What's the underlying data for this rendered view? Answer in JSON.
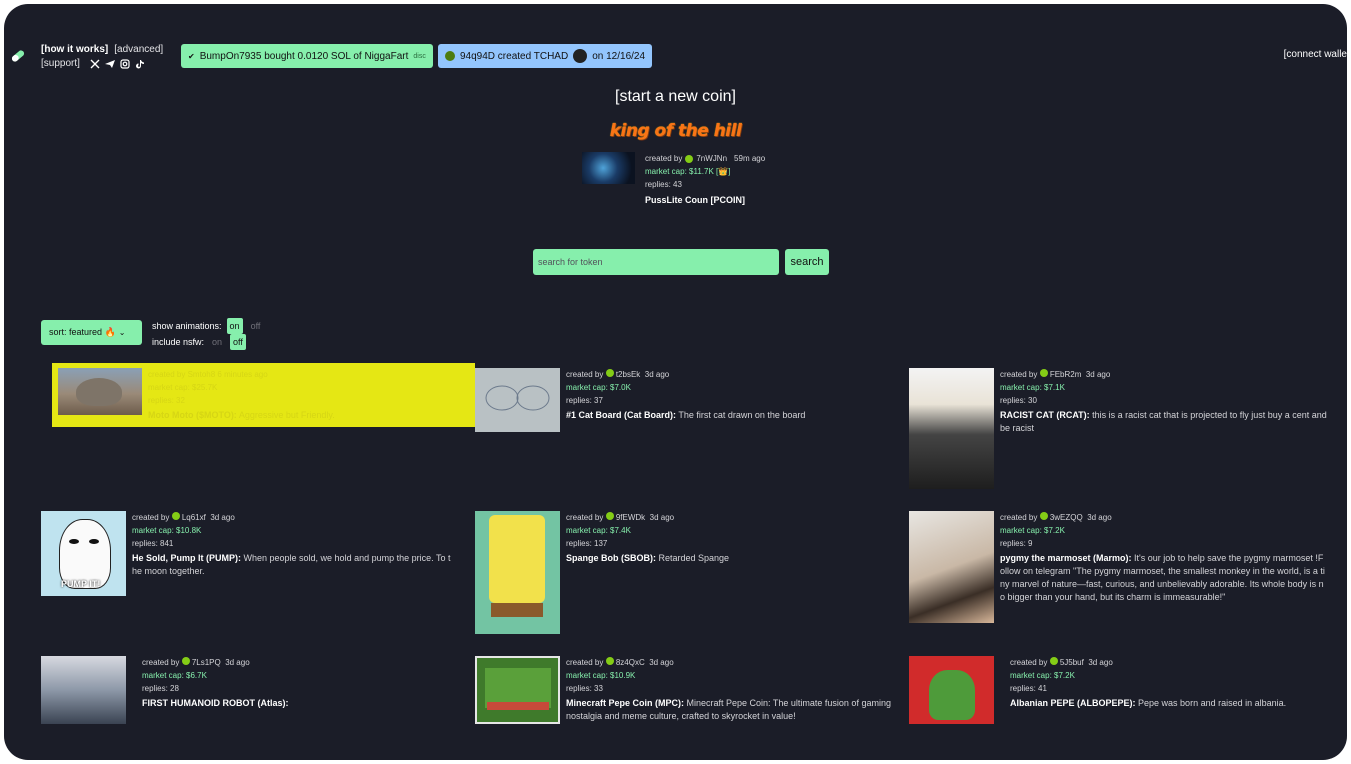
{
  "nav": {
    "how_it_works": "[how it works]",
    "advanced": "[advanced]",
    "support": "[support]",
    "connect": "[connect walle"
  },
  "ticker": {
    "trade": "BumpOn7935  bought 0.0120 SOL of NiggaFart",
    "trade_tag": "disc",
    "create_user": "94q94D created TCHAD",
    "create_date": "on 12/16/24"
  },
  "hero": {
    "start": "[start a new coin]",
    "koth": "king of the hill",
    "creator_label": "created by",
    "creator": "7nWJNn",
    "age": "59m ago",
    "cap": "market cap: $11.7K [",
    "cap_end": "]",
    "replies": "replies: 43",
    "title": "PussLite Coun [PCOIN]"
  },
  "search": {
    "placeholder": "search for token",
    "button": "search"
  },
  "controls": {
    "sort": "sort: featured 🔥",
    "animations_label": "show animations:",
    "nsfw_label": "include nsfw:",
    "on": "on",
    "off": "off"
  },
  "cards": [
    {
      "creator": "Smtoh8",
      "age": "6 minutes ago",
      "cap": "market cap: $25.7K",
      "replies": "replies: 32",
      "name": "Moto Moto ($MOTO):",
      "text": " Aggressive but Friendly."
    },
    {
      "creator": "t2bsEk",
      "age": "3d ago",
      "cap": "market cap: $7.0K",
      "replies": "replies: 37",
      "name": "#1 Cat Board (Cat Board):",
      "text": " The first cat drawn on the board"
    },
    {
      "creator": "FEbR2m",
      "age": "3d ago",
      "cap": "market cap: $7.1K",
      "replies": "replies: 30",
      "name": "RACIST CAT (RCAT):",
      "text": " this is a racist cat that is projected to fly just buy a cent and be racist"
    },
    {
      "creator": "Lq61xf",
      "age": "3d ago",
      "cap": "market cap: $10.8K",
      "replies": "replies: 841",
      "name": "He Sold, Pump It (PUMP):",
      "text": " When people sold, we hold and pump the price. To the moon together."
    },
    {
      "creator": "9fEWDk",
      "age": "3d ago",
      "cap": "market cap: $7.4K",
      "replies": "replies: 137",
      "name": "Spange Bob (SBOB):",
      "text": " Retarded Spange"
    },
    {
      "creator": "3wEZQQ",
      "age": "3d ago",
      "cap": "market cap: $7.2K",
      "replies": "replies: 9",
      "name": "pygmy the marmoset (Marmo):",
      "text": " It's our job to help save the pygmy marmoset !Follow on telegram \"The pygmy marmoset, the smallest monkey in the world, is a tiny marvel of nature—fast, curious, and unbelievably adorable. Its whole body is no bigger than your hand, but its charm is immeasurable!\""
    },
    {
      "creator": "7Ls1PQ",
      "age": "3d ago",
      "cap": "market cap: $6.7K",
      "replies": "replies: 28",
      "name": "FIRST HUMANOID ROBOT (Atlas):",
      "text": ""
    },
    {
      "creator": "8z4QxC",
      "age": "3d ago",
      "cap": "market cap: $10.9K",
      "replies": "replies: 33",
      "name": "Minecraft Pepe Coin (MPC):",
      "text": " Minecraft Pepe Coin: The ultimate fusion of gaming nostalgia and meme culture, crafted to skyrocket in value!"
    },
    {
      "creator": "5J5buf",
      "age": "3d ago",
      "cap": "market cap: $7.2K",
      "replies": "replies: 41",
      "name": "Albanian PEPE (ALBOPEPE):",
      "text": " Pepe was born and raised in albania."
    }
  ],
  "labels": {
    "created_by": "created by"
  },
  "thumb_art": {
    "0": "PUMP IT!"
  }
}
